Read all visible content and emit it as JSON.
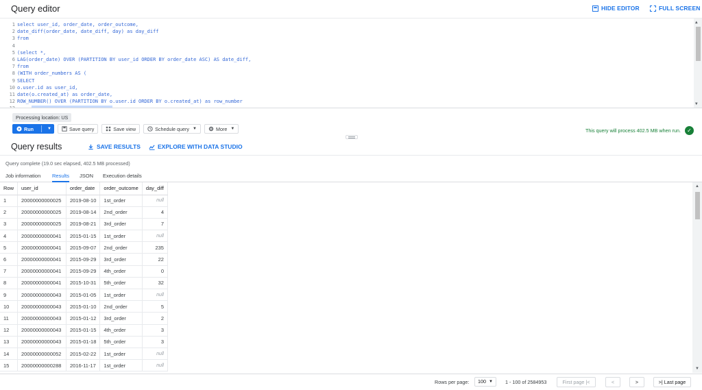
{
  "header": {
    "title": "Query editor",
    "hide_editor": "HIDE EDITOR",
    "full_screen": "FULL SCREEN"
  },
  "editor": {
    "line_numbers": [
      "1",
      "2",
      "3",
      "4",
      "5",
      "6",
      "7",
      "8",
      "9",
      "10",
      "11",
      "12",
      "13"
    ],
    "lines": [
      "select user_id, order_date, order_outcome,",
      "date_diff(order_date, date_diff, day) as day_diff",
      "from",
      "",
      "(select *,",
      "LAG(order_date) OVER (PARTITION BY user_id ORDER BY order_date ASC) AS date_diff,",
      "from",
      "(WITH order_numbers AS (",
      "SELECT",
      "o.user.id as user_id,",
      "date(o.created_at) as order_date,",
      "ROW_NUMBER() OVER (PARTITION BY o.user.id ORDER BY o.created_at) as row_number",
      ""
    ]
  },
  "processing_location": "Processing location: US",
  "toolbar": {
    "run": "Run",
    "save_query": "Save query",
    "save_view": "Save view",
    "schedule_query": "Schedule query",
    "more": "More"
  },
  "validator_message": "This query will process 402.5 MB when run.",
  "results": {
    "title": "Query results",
    "save_results": "SAVE RESULTS",
    "explore": "EXPLORE WITH DATA STUDIO",
    "status": "Query complete (19.0 sec elapsed, 402.5 MB processed)",
    "tabs": [
      "Job information",
      "Results",
      "JSON",
      "Execution details"
    ],
    "active_tab": "Results",
    "columns": [
      "Row",
      "user_id",
      "order_date",
      "order_outcome",
      "day_diff"
    ],
    "rows": [
      [
        "1",
        "20000000000025",
        "2019-08-10",
        "1st_order",
        "null"
      ],
      [
        "2",
        "20000000000025",
        "2019-08-14",
        "2nd_order",
        "4"
      ],
      [
        "3",
        "20000000000025",
        "2019-08-21",
        "3rd_order",
        "7"
      ],
      [
        "4",
        "20000000000041",
        "2015-01-15",
        "1st_order",
        "null"
      ],
      [
        "5",
        "20000000000041",
        "2015-09-07",
        "2nd_order",
        "235"
      ],
      [
        "6",
        "20000000000041",
        "2015-09-29",
        "3rd_order",
        "22"
      ],
      [
        "7",
        "20000000000041",
        "2015-09-29",
        "4th_order",
        "0"
      ],
      [
        "8",
        "20000000000041",
        "2015-10-31",
        "5th_order",
        "32"
      ],
      [
        "9",
        "20000000000043",
        "2015-01-05",
        "1st_order",
        "null"
      ],
      [
        "10",
        "20000000000043",
        "2015-01-10",
        "2nd_order",
        "5"
      ],
      [
        "11",
        "20000000000043",
        "2015-01-12",
        "3rd_order",
        "2"
      ],
      [
        "12",
        "20000000000043",
        "2015-01-15",
        "4th_order",
        "3"
      ],
      [
        "13",
        "20000000000043",
        "2015-01-18",
        "5th_order",
        "3"
      ],
      [
        "14",
        "20000000000052",
        "2015-02-22",
        "1st_order",
        "null"
      ],
      [
        "15",
        "20000000000288",
        "2016-11-17",
        "1st_order",
        "null"
      ]
    ]
  },
  "pagination": {
    "rows_per_page_label": "Rows per page:",
    "rows_per_page": "100",
    "range": "1 - 100 of 2584953",
    "first_page": "First page",
    "last_page": "Last page"
  },
  "colors": {
    "accent": "#1a73e8",
    "success": "#188038"
  }
}
